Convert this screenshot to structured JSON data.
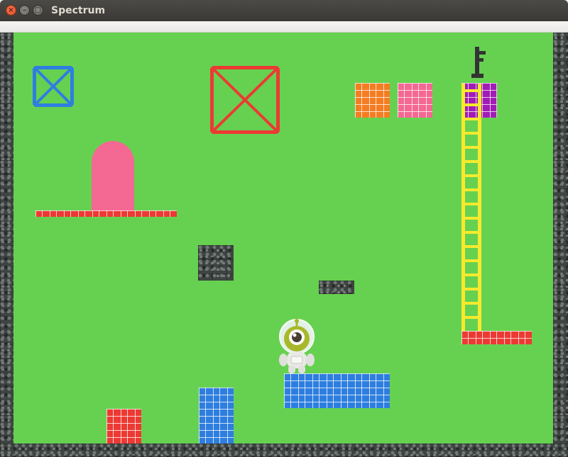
{
  "window": {
    "title": "Spectrum",
    "close_glyph": "×",
    "min_glyph": "–",
    "max_glyph": "□"
  },
  "colors": {
    "grass": "#66d150",
    "blue": "#2e7ee0",
    "red": "#ec3a33",
    "orange": "#f47d22",
    "pink": "#f46894",
    "purple": "#a11cb4",
    "yellow": "#f7ea2e",
    "key": "#333333"
  },
  "scene": {
    "player": "alien-astronaut",
    "exit_key": "key-icon",
    "door": "pink-arch-door",
    "crates": [
      "blue-x-crate",
      "red-x-crate"
    ],
    "ladder": "yellow-ladder"
  }
}
